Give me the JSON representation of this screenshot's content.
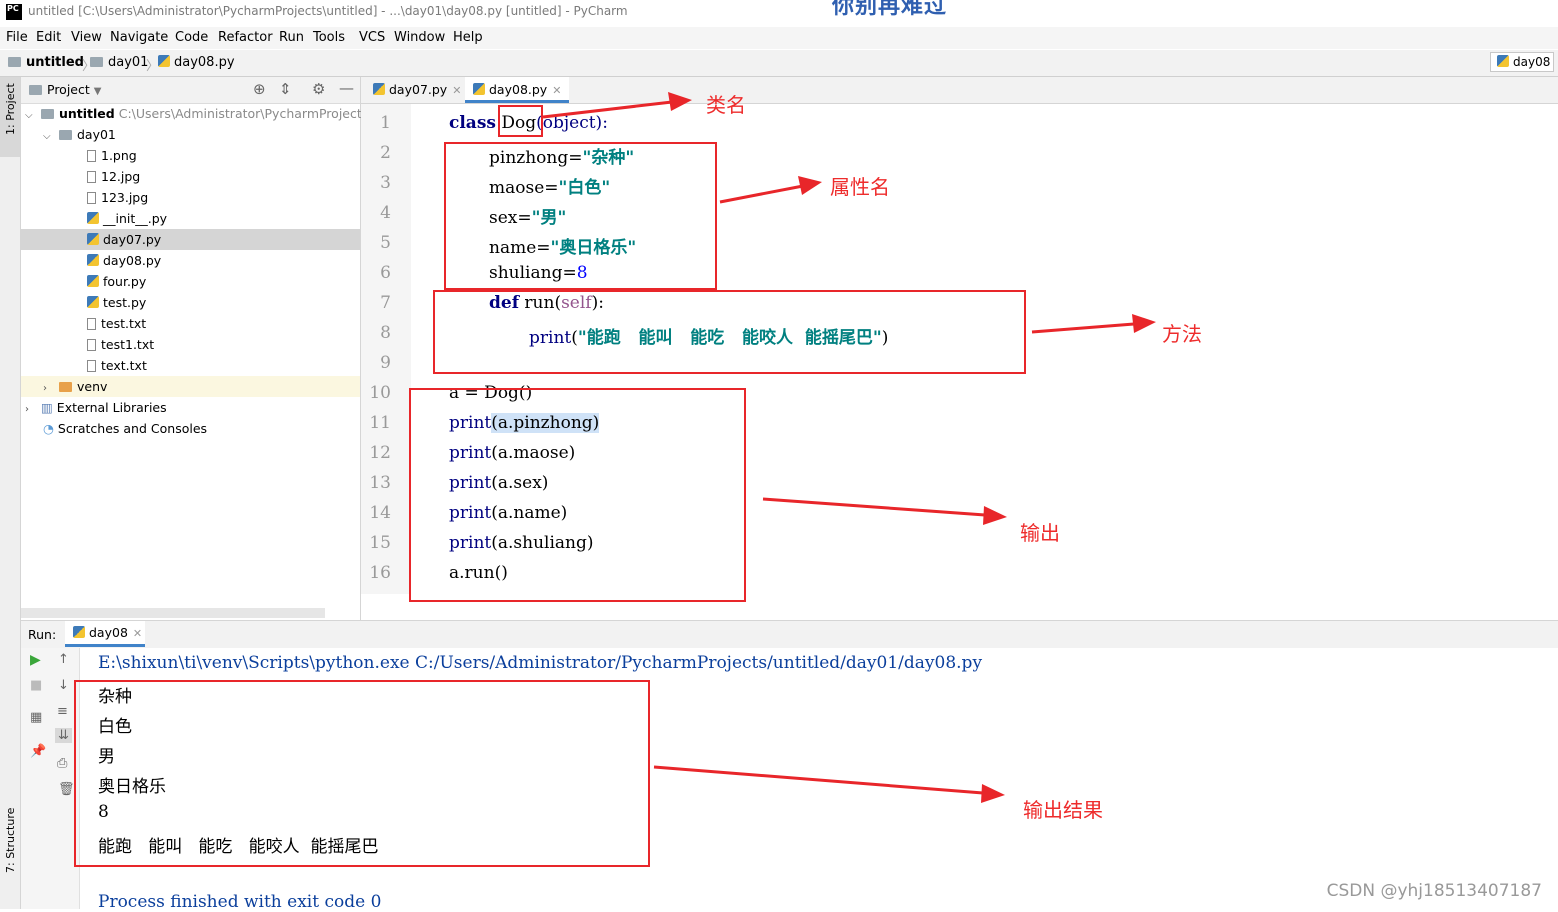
{
  "window": {
    "logo_text": "PC",
    "title": "untitled [C:\\Users\\Administrator\\PycharmProjects\\untitled] - ...\\day01\\day08.py [untitled] - PyCharm",
    "overlay_title": "你别再难过"
  },
  "menu": [
    "File",
    "Edit",
    "View",
    "Navigate",
    "Code",
    "Refactor",
    "Run",
    "Tools",
    "VCS",
    "Window",
    "Help"
  ],
  "breadcrumb": [
    "untitled",
    "day01",
    "day08.py"
  ],
  "run_config": "day08",
  "left_strip": {
    "project": "1: Project",
    "structure": "7: Structure"
  },
  "project_panel": {
    "title": "Project",
    "root": {
      "name": "untitled",
      "path": "C:\\Users\\Administrator\\PycharmProjects\\u"
    },
    "folder": "day01",
    "files": [
      "1.png",
      "12.jpg",
      "123.jpg",
      "__init__.py",
      "day07.py",
      "day08.py",
      "four.py",
      "test.py",
      "test.txt",
      "test1.txt",
      "text.txt"
    ],
    "venv": "venv",
    "external": "External Libraries",
    "scratches": "Scratches and Consoles"
  },
  "editor": {
    "tabs": [
      "day07.py",
      "day08.py"
    ],
    "line_numbers": [
      "1",
      "2",
      "3",
      "4",
      "5",
      "6",
      "7",
      "8",
      "9",
      "10",
      "11",
      "12",
      "13",
      "14",
      "15",
      "16"
    ],
    "code": {
      "l1_kw": "class",
      "l1_rest": " Dog",
      "l1_paren": "(object):",
      "l2_var": "pinzhong=",
      "l2_str": "\"杂种\"",
      "l3_var": "maose=",
      "l3_str": "\"白色\"",
      "l4_var": "sex=",
      "l4_str": "\"男\"",
      "l5_var": "name=",
      "l5_str": "\"奥日格乐\"",
      "l6_var": "shuliang=",
      "l6_num": "8",
      "l7_kw": "def",
      "l7_name": " run(",
      "l7_self": "self",
      "l7_end": "):",
      "l8_bi": "print",
      "l8_open": "(",
      "l8_str": "\"能跑   能叫   能吃   能咬人  能摇尾巴\"",
      "l8_close": ")",
      "l10": "a = Dog()",
      "print_kw": "print",
      "l11": "(a.pinzhong)",
      "l12": "(a.maose)",
      "l13": "(a.sex)",
      "l14": "(a.name)",
      "l15": "(a.shuliang)",
      "l16": "a.run()"
    }
  },
  "run_panel": {
    "label": "Run:",
    "tab": "day08",
    "command": "E:\\shixun\\ti\\venv\\Scripts\\python.exe C:/Users/Administrator/PycharmProjects/untitled/day01/day08.py",
    "output": [
      "杂种",
      "白色",
      "男",
      "奥日格乐",
      "8",
      "能跑   能叫   能吃   能咬人  能摇尾巴"
    ],
    "exit_message": "Process finished with exit code 0"
  },
  "annotations": {
    "class_name": "类名",
    "attribute_names": "属性名",
    "method": "方法",
    "output": "输出",
    "output_result": "输出结果"
  },
  "watermark": "CSDN @yhj18513407187",
  "colors": {
    "annotation_red": "#e8262a",
    "keyword": "#000080",
    "string": "#008080",
    "number": "#0000ff",
    "console_blue": "#0b3f9c"
  }
}
